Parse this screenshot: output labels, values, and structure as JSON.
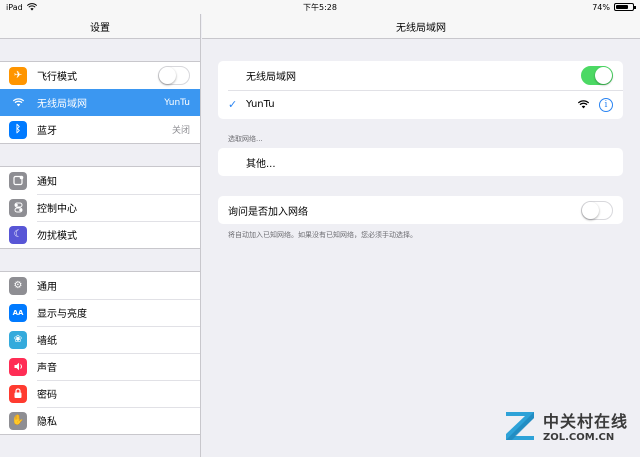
{
  "status_bar": {
    "device": "iPad",
    "time": "下午5:28",
    "battery": "74%",
    "battery_level": 0.74
  },
  "sidebar": {
    "title": "设置",
    "groups": [
      [
        {
          "label": "飞行模式",
          "icon": "airplane-icon",
          "color": "#ff9500",
          "toggle": false
        },
        {
          "label": "无线局域网",
          "icon": "wifi-icon",
          "color": "#3b97f1",
          "value": "YunTu",
          "selected": true
        },
        {
          "label": "蓝牙",
          "icon": "bluetooth-icon",
          "color": "#007aff",
          "value": "关闭"
        }
      ],
      [
        {
          "label": "通知",
          "icon": "notifications-icon",
          "color": "#8e8e93"
        },
        {
          "label": "控制中心",
          "icon": "control-center-icon",
          "color": "#8e8e93"
        },
        {
          "label": "勿扰模式",
          "icon": "moon-icon",
          "color": "#5856d6"
        }
      ],
      [
        {
          "label": "通用",
          "icon": "gear-icon",
          "color": "#8e8e93"
        },
        {
          "label": "显示与亮度",
          "icon": "display-icon",
          "color": "#007aff"
        },
        {
          "label": "墙纸",
          "icon": "wallpaper-icon",
          "color": "#34aadc"
        },
        {
          "label": "声音",
          "icon": "sound-icon",
          "color": "#ff2d55"
        },
        {
          "label": "密码",
          "icon": "lock-icon",
          "color": "#ff3b30"
        },
        {
          "label": "隐私",
          "icon": "hand-icon",
          "color": "#8e8e93"
        }
      ]
    ]
  },
  "detail": {
    "title": "无线局域网",
    "wifi_label": "无线局域网",
    "wifi_on": true,
    "connected_network": "YunTu",
    "choose_network_label": "选取网络...",
    "other_label": "其他...",
    "ask_to_join_label": "询问是否加入网络",
    "ask_to_join_on": false,
    "ask_to_join_note": "将自动加入已知网络。如果没有已知网络，您必须手动选择。"
  },
  "watermark": {
    "cn": "中关村在线",
    "en": "ZOL.COM.CN"
  }
}
